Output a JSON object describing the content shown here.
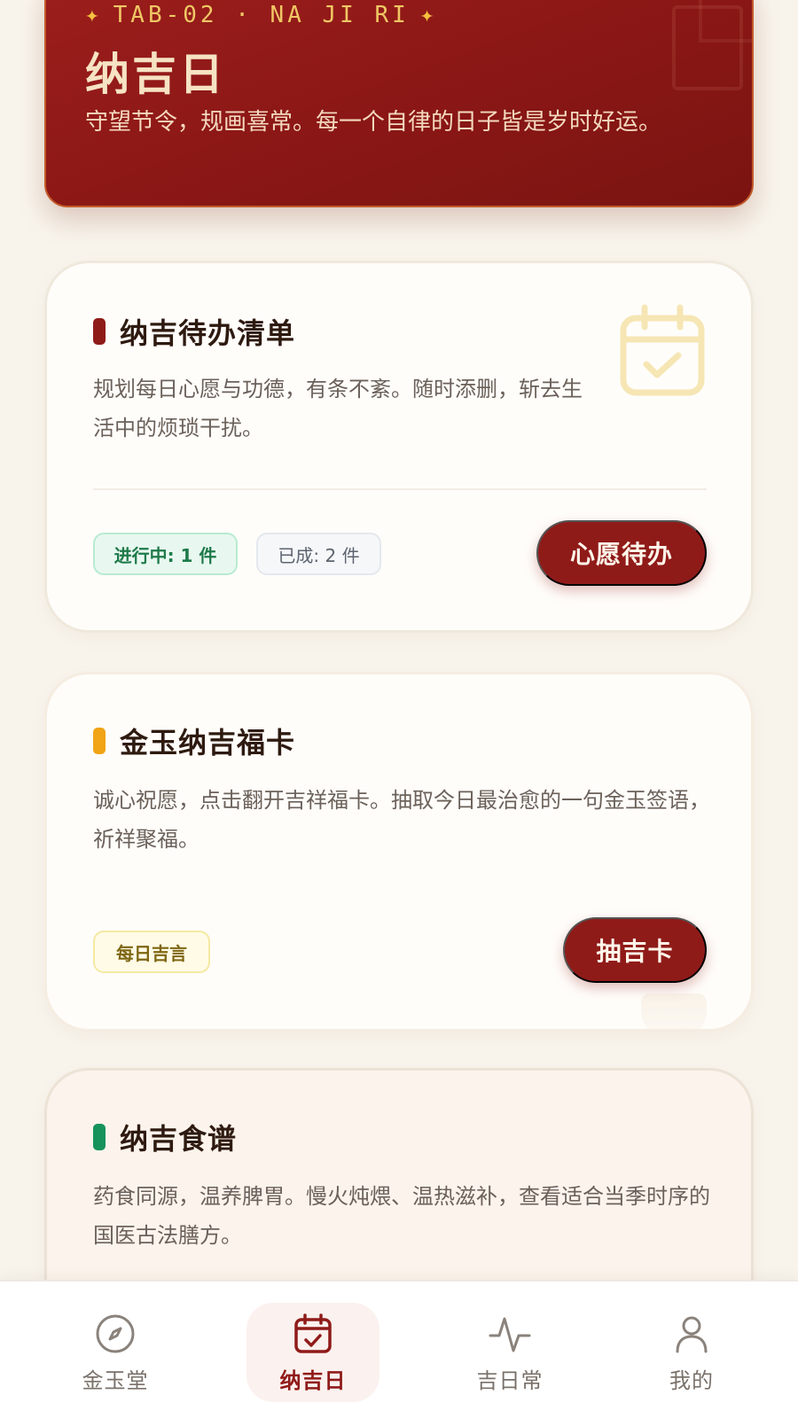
{
  "hero": {
    "tag": "TAB-02 · NA JI RI",
    "title": "纳吉日",
    "subtitle": "守望节令，规画喜常。每一个自律的日子皆是岁时好运。"
  },
  "cards": [
    {
      "title": "纳吉待办清单",
      "accent_color": "#8f1b19",
      "description": "规划每日心愿与功德，有条不紊。随时添删，斩去生活中的烦琐干扰。",
      "pills": [
        "进行中: 1 件",
        "已成: 2 件"
      ],
      "button": "心愿待办",
      "icon": "calendar-check-icon"
    },
    {
      "title": "金玉纳吉福卡",
      "accent_color": "#f0a416",
      "description": "诚心祝愿，点击翻开吉祥福卡。抽取今日最治愈的一句金玉签语，祈祥聚福。",
      "pills": [
        "每日吉言"
      ],
      "button": "抽吉卡"
    },
    {
      "title": "纳吉食谱",
      "accent_color": "#15935a",
      "description": "药食同源，温养脾胃。慢火炖煨、温热滋补，查看适合当季时序的国医古法膳方。"
    }
  ],
  "nav": {
    "active_color": "#8f1b19",
    "items": [
      {
        "label": "金玉堂",
        "icon": "compass-icon"
      },
      {
        "label": "纳吉日",
        "icon": "calendar-check-icon"
      },
      {
        "label": "吉日常",
        "icon": "pulse-icon"
      },
      {
        "label": "我的",
        "icon": "user-icon"
      }
    ]
  }
}
